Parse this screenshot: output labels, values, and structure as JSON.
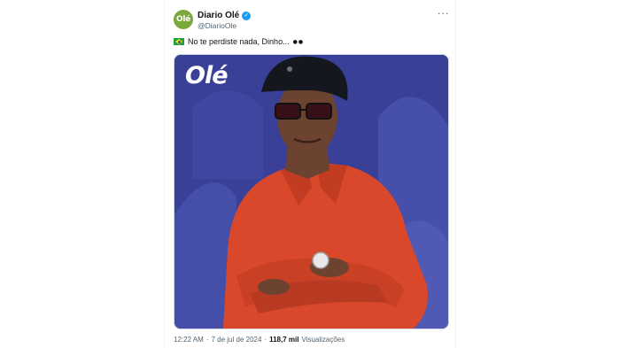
{
  "author": {
    "display_name": "Diario Olé",
    "handle": "@DiarioOle",
    "avatar_text": "Olé",
    "verified": true
  },
  "tweet": {
    "text": "No te perdiste nada, Dinho...",
    "flag_icon": "brazil-flag-icon",
    "eyes": "●●",
    "more_label": "···"
  },
  "media": {
    "watermark": "Olé"
  },
  "meta": {
    "time": "12:22 AM",
    "separator": "·",
    "date": "7 de jul de 2024",
    "separator2": "·",
    "views_count": "118,7 mil",
    "views_label": "Visualizações"
  },
  "colors": {
    "accent": "#1d9bf0",
    "avatar_bg": "#7aa83a",
    "media_bg": "#3a3f97",
    "shirt": "#d9482b"
  }
}
